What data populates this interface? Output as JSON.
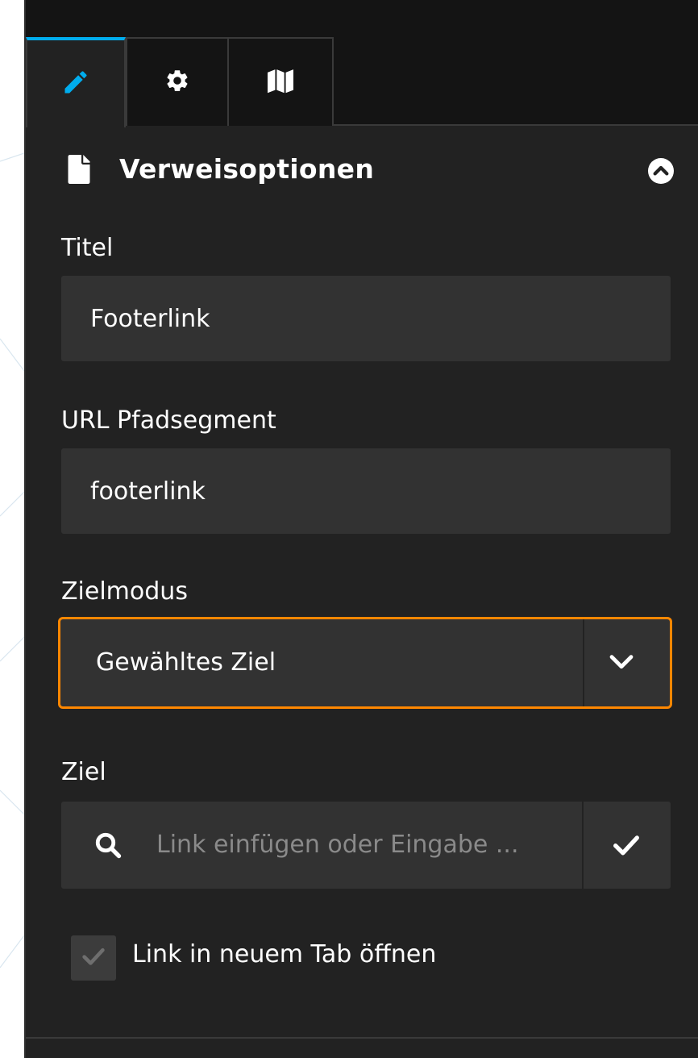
{
  "tabs": [
    {
      "name": "edit",
      "icon": "pencil-icon",
      "active": true
    },
    {
      "name": "settings",
      "icon": "gear-icon",
      "active": false
    },
    {
      "name": "map",
      "icon": "map-icon",
      "active": false
    }
  ],
  "section": {
    "title": "Verweisoptionen",
    "icon": "file-icon",
    "toggle_icon": "chevron-up-circle-icon"
  },
  "fields": {
    "title": {
      "label": "Titel",
      "value": "Footerlink"
    },
    "url_segment": {
      "label": "URL Pfadsegment",
      "value": "footerlink"
    },
    "target_mode": {
      "label": "Zielmodus",
      "value": "Gewähltes Ziel"
    },
    "target": {
      "label": "Ziel",
      "placeholder": "Link einfügen oder Eingabe ..."
    }
  },
  "open_new_tab": {
    "label": "Link in neuem Tab öffnen",
    "checked": true
  },
  "colors": {
    "accent": "#00adee",
    "focus": "#ff8700",
    "panel": "#222222",
    "field": "#323232"
  }
}
